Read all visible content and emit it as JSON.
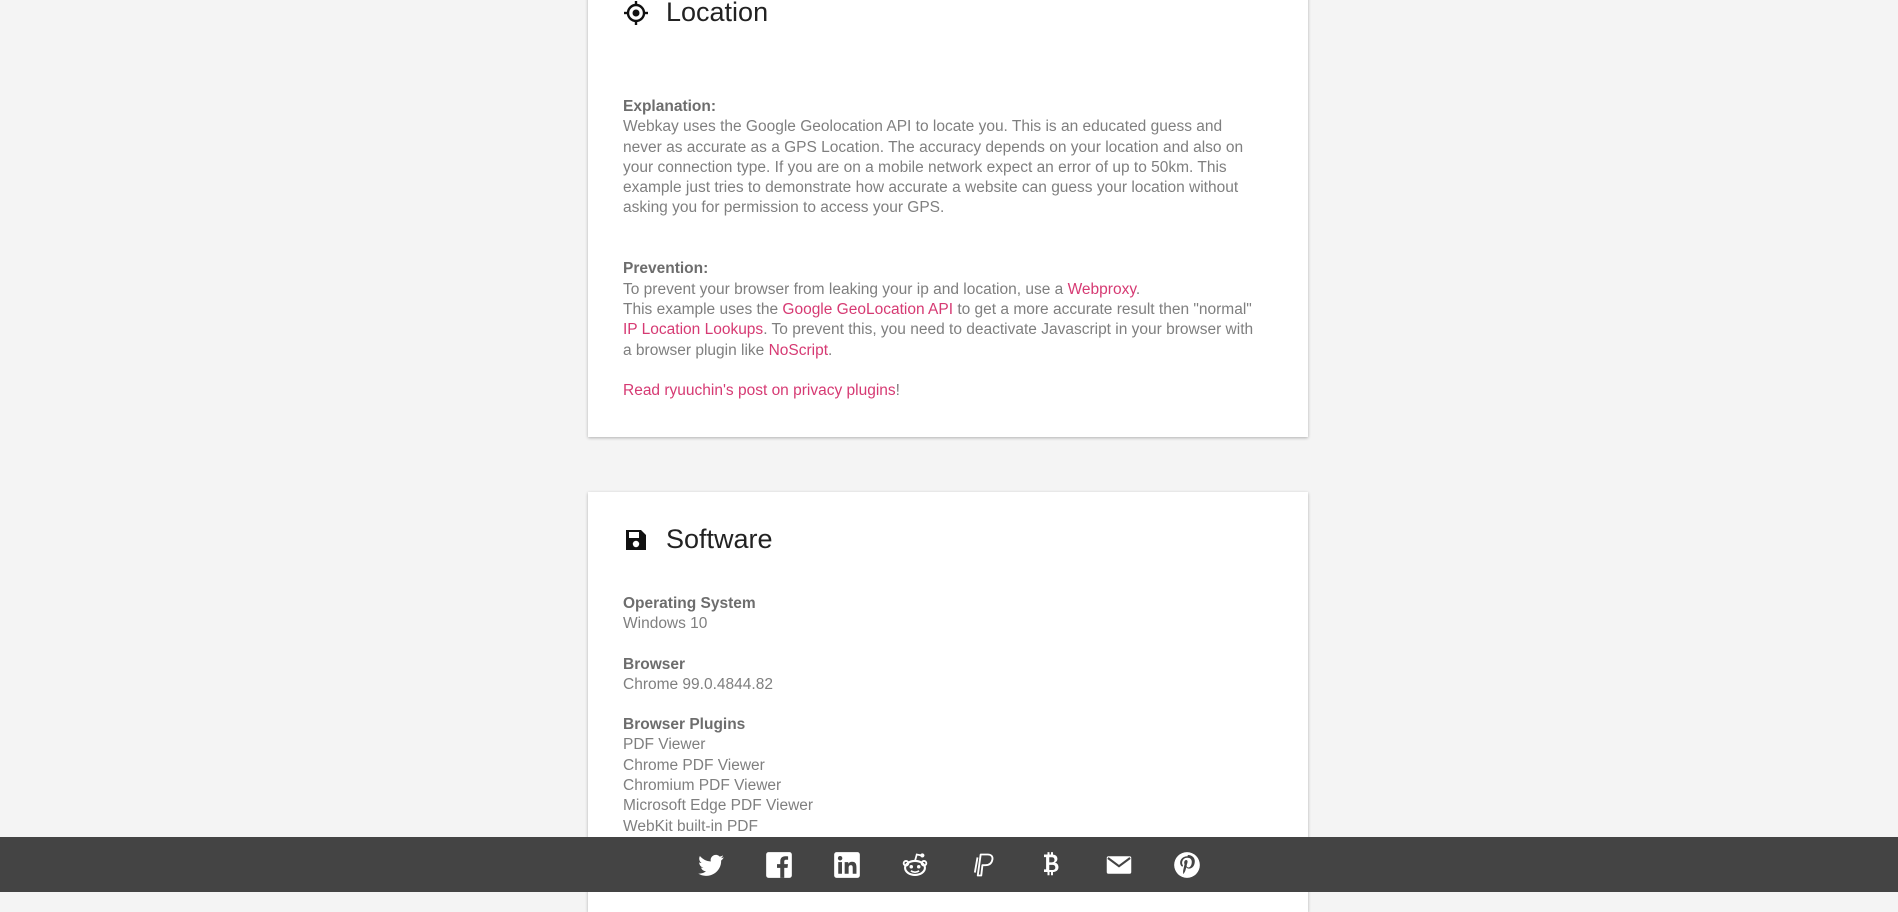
{
  "location": {
    "title": "Location",
    "icon": "crosshair-icon",
    "explanation_label": "Explanation:",
    "explanation_text": "Webkay uses the Google Geolocation API to locate you. This is an educated guess and never as accurate as a GPS Location. The accuracy depends on your location and also on your connection type. If you are on a mobile network expect an error of up to 50km. This example just tries to demonstrate how accurate a website can guess your location without asking you for permission to access your GPS.",
    "prevention_label": "Prevention:",
    "prev_line1_pre": "To prevent your browser from leaking your ip and location, use a ",
    "prev_link_webproxy": "Webproxy",
    "prev_line1_post": ".",
    "prev_line2_pre": "This example uses the ",
    "prev_link_geo_api": "Google GeoLocation API",
    "prev_line2_mid": " to get a more accurate result then \"normal\" ",
    "prev_link_ip_lookups": "IP Location Lookups",
    "prev_line2_mid2": ". To prevent this, you need to deactivate Javascript in your browser with a browser plugin like ",
    "prev_link_noscript": "NoScript",
    "prev_line2_post": ".",
    "read_post_link": "Read ryuuchin's post on privacy plugins",
    "read_post_suffix": "!"
  },
  "software": {
    "title": "Software",
    "icon": "floppy-disk-icon",
    "os_label": "Operating System",
    "os_value": "Windows 10",
    "browser_label": "Browser",
    "browser_value": "Chrome 99.0.4844.82",
    "plugins_label": "Browser Plugins",
    "plugins": [
      "PDF Viewer",
      "Chrome PDF Viewer",
      "Chromium PDF Viewer",
      "Microsoft Edge PDF Viewer",
      "WebKit built-in PDF"
    ]
  },
  "footer": {
    "share_icons": [
      "twitter-icon",
      "facebook-icon",
      "linkedin-icon",
      "reddit-icon",
      "paypal-icon",
      "bitcoin-icon",
      "email-icon",
      "pinterest-icon"
    ]
  },
  "colors": {
    "background": "#f4f4f4",
    "card": "#ffffff",
    "link": "#d63a73",
    "footer": "#444444"
  }
}
